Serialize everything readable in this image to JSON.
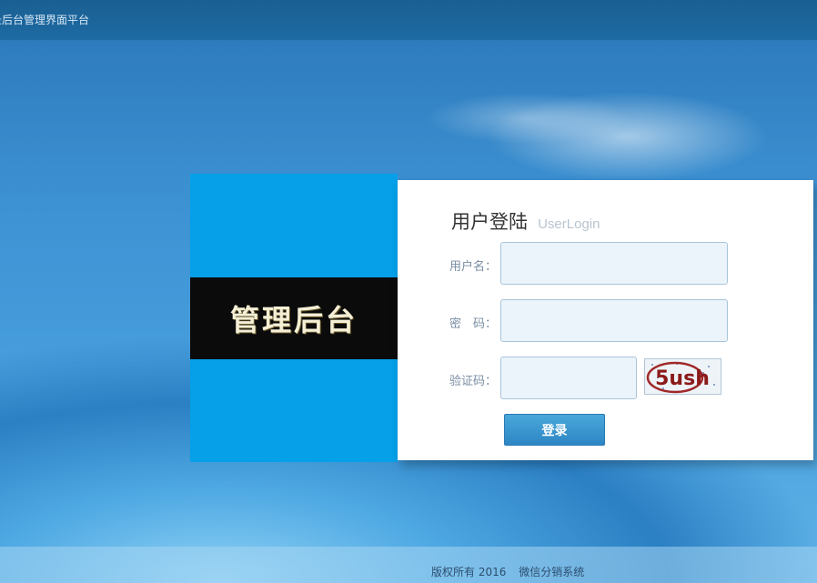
{
  "header": {
    "title": "录后台管理界面平台"
  },
  "banner": {
    "text": "管理后台"
  },
  "login": {
    "title": "用户登陆",
    "subtitle": "UserLogin",
    "username_label": "用户名：",
    "username_value": "",
    "password_label": "密　码：",
    "password_value": "",
    "captcha_label": "验证码：",
    "captcha_value": "",
    "captcha_text": "5ush",
    "submit_label": "登录"
  },
  "footer": {
    "copyright": "版权所有 2016",
    "system_name": "微信分销系统"
  },
  "colors": {
    "accent": "#05a0e8",
    "button": "#2d86c4",
    "topbar": "#1a5f92"
  }
}
